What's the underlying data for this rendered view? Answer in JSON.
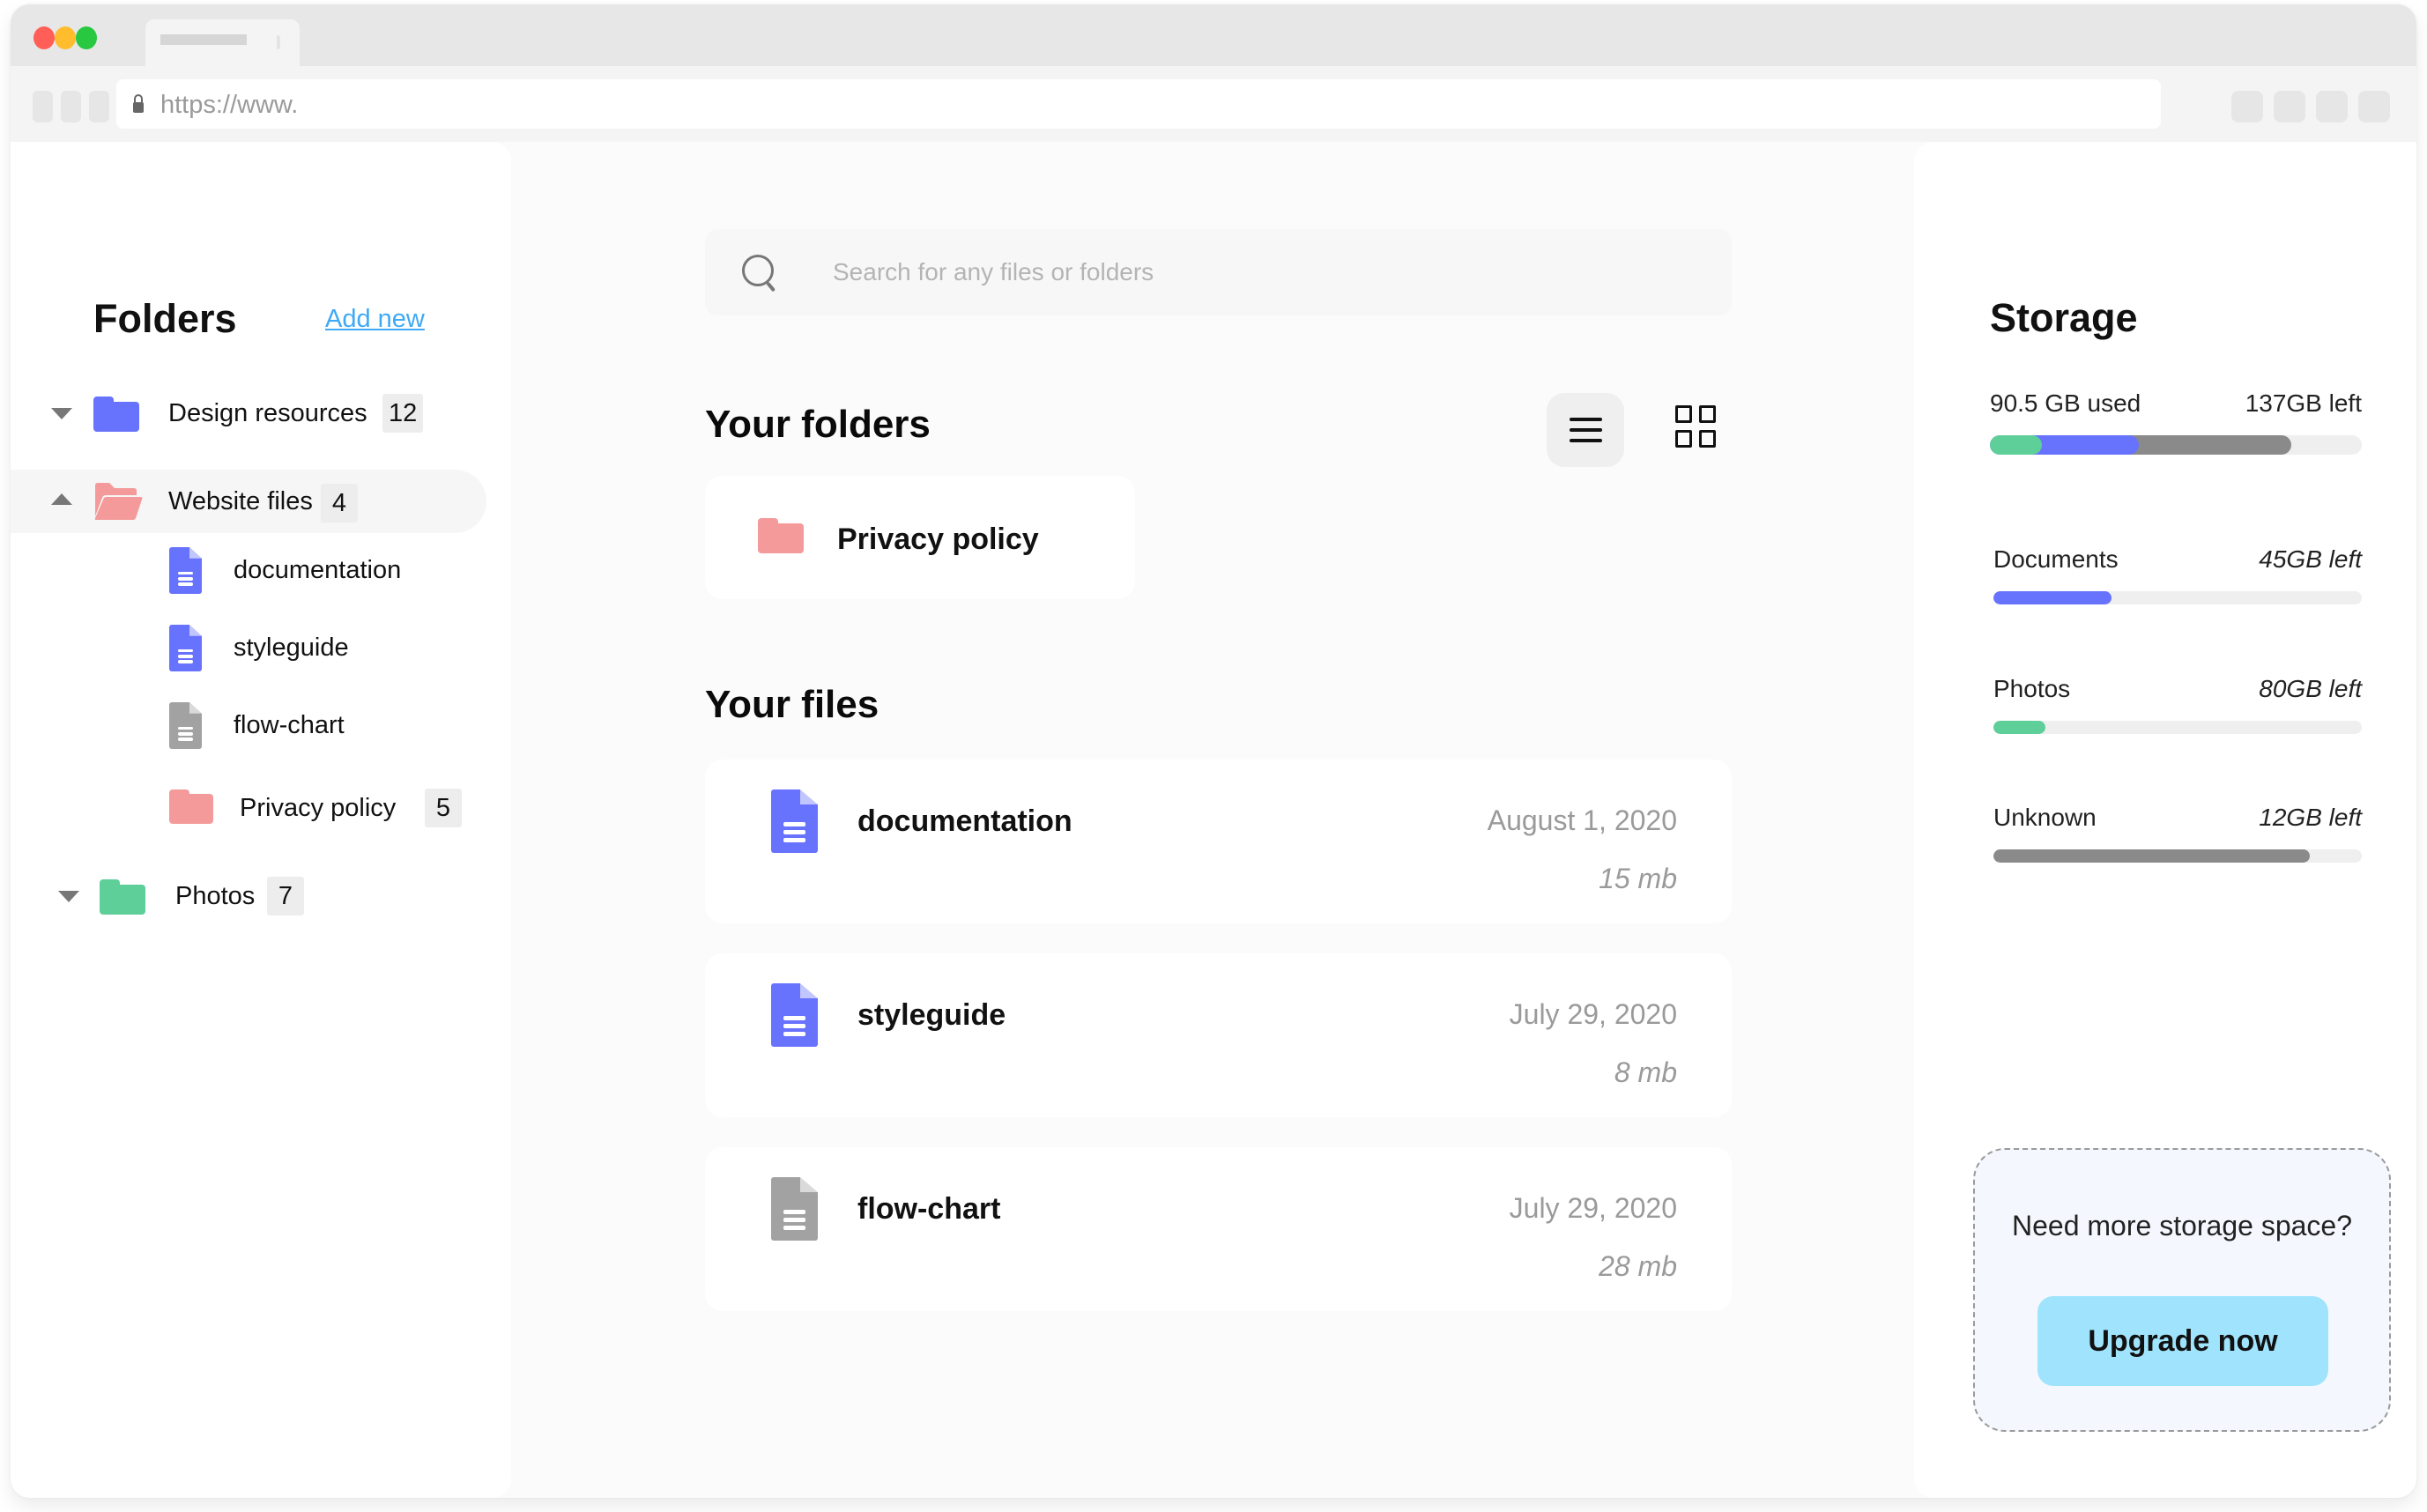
{
  "browser": {
    "url": "https://www.",
    "window_controls": [
      "close",
      "minimize",
      "maximize"
    ]
  },
  "sidebar": {
    "title": "Folders",
    "add_new_label": "Add new",
    "tree": [
      {
        "label": "Design resources",
        "count": "12",
        "type": "folder",
        "color": "#6772fd",
        "expanded": false
      },
      {
        "label": "Website files",
        "count": "4",
        "type": "folder-open",
        "color": "#f59a9a",
        "expanded": true,
        "active": true,
        "children": [
          {
            "label": "documentation",
            "type": "document",
            "color": "#6772fd"
          },
          {
            "label": "styleguide",
            "type": "document",
            "color": "#6772fd"
          },
          {
            "label": "flow-chart",
            "type": "document",
            "color": "#a2a2a2"
          },
          {
            "label": "Privacy policy",
            "count": "5",
            "type": "folder",
            "color": "#f59a9a"
          }
        ]
      },
      {
        "label": "Photos",
        "count": "7",
        "type": "folder",
        "color": "#5fcf9a",
        "expanded": false
      }
    ]
  },
  "main": {
    "search": {
      "placeholder": "Search for any files or folders",
      "value": ""
    },
    "folders_heading": "Your folders",
    "view_toggle": {
      "active": "list",
      "options": [
        "list",
        "grid"
      ]
    },
    "folders": [
      {
        "label": "Privacy policy",
        "color": "#f59a9a"
      }
    ],
    "files_heading": "Your files",
    "files": [
      {
        "name": "documentation",
        "date": "August 1, 2020",
        "size": "15 mb",
        "color": "#6772fd"
      },
      {
        "name": "styleguide",
        "date": "July 29, 2020",
        "size": "8 mb",
        "color": "#6772fd"
      },
      {
        "name": "flow-chart",
        "date": "July 29, 2020",
        "size": "28 mb",
        "color": "#a2a2a2"
      }
    ]
  },
  "storage": {
    "title": "Storage",
    "used_label": "90.5 GB used",
    "left_label": "137GB left",
    "overall_segments": [
      {
        "name": "Photos",
        "fraction": 0.14,
        "color": "#5fcf9a"
      },
      {
        "name": "Documents",
        "fraction": 0.26,
        "color": "#6772fd"
      },
      {
        "name": "Unknown",
        "fraction": 0.41,
        "color": "#8a8a8a"
      }
    ],
    "categories": [
      {
        "name": "Documents",
        "left": "45GB left",
        "fraction": 0.32,
        "color": "#6772fd"
      },
      {
        "name": "Photos",
        "left": "80GB left",
        "fraction": 0.14,
        "color": "#5fcf9a"
      },
      {
        "name": "Unknown",
        "left": "12GB left",
        "fraction": 0.86,
        "color": "#8a8a8a"
      }
    ],
    "upsell": {
      "text": "Need more storage space?",
      "button_label": "Upgrade now"
    }
  }
}
